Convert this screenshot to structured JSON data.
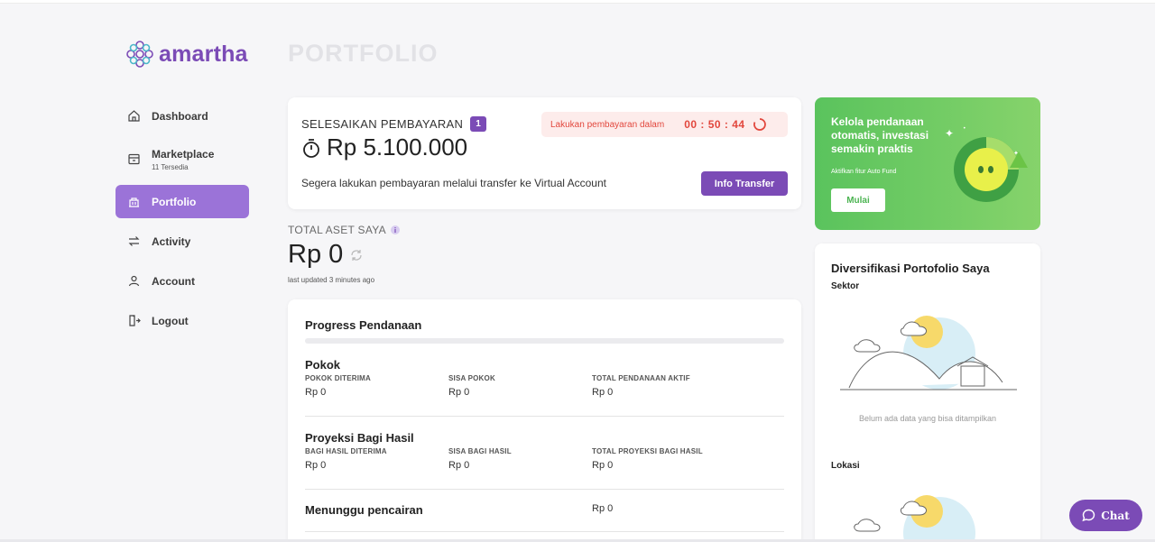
{
  "brand": {
    "name": "amartha"
  },
  "page": {
    "title": "PORTFOLIO"
  },
  "sidebar": {
    "items": [
      {
        "label": "Dashboard",
        "icon": "home-icon",
        "active": false
      },
      {
        "label": "Marketplace",
        "sub": "11 Tersedia",
        "icon": "store-icon",
        "active": false
      },
      {
        "label": "Portfolio",
        "icon": "portfolio-icon",
        "active": true
      },
      {
        "label": "Activity",
        "icon": "swap-icon",
        "active": false
      },
      {
        "label": "Account",
        "icon": "user-icon",
        "active": false
      },
      {
        "label": "Logout",
        "icon": "logout-icon",
        "active": false
      }
    ]
  },
  "payment": {
    "title": "SELESAIKAN PEMBAYARAN",
    "badge": "1",
    "amount": "Rp 5.100.000",
    "timer_label": "Lakukan pembayaran dalam",
    "timer_value": "00 : 50 : 44",
    "note": "Segera lakukan pembayaran melalui transfer ke Virtual Account",
    "button": "Info Transfer"
  },
  "assets": {
    "label": "TOTAL ASET SAYA",
    "value": "Rp 0",
    "updated": "last updated 3 minutes ago"
  },
  "progress": {
    "title": "Progress Pendanaan",
    "fill_fraction": 0,
    "sections": [
      {
        "title": "Pokok",
        "cols": [
          {
            "key": "POKOK DITERIMA",
            "value": "Rp 0"
          },
          {
            "key": "SISA POKOK",
            "value": "Rp 0"
          },
          {
            "key": "TOTAL PENDANAAN AKTIF",
            "value": "Rp 0"
          }
        ]
      },
      {
        "title": "Proyeksi Bagi Hasil",
        "cols": [
          {
            "key": "BAGI HASIL DITERIMA",
            "value": "Rp 0"
          },
          {
            "key": "SISA BAGI HASIL",
            "value": "Rp 0"
          },
          {
            "key": "TOTAL PROYEKSI BAGI HASIL",
            "value": "Rp 0"
          }
        ]
      }
    ],
    "waiting": {
      "label": "Menunggu pencairan",
      "value": "Rp 0"
    }
  },
  "promo": {
    "text": "Kelola pendanaan otomatis, investasi semakin praktis",
    "sub": "Aktifkan fitur Auto Fund",
    "button": "Mulai"
  },
  "diversification": {
    "title": "Diversifikasi Portofolio Saya",
    "sector_label": "Sektor",
    "empty_text": "Belum ada data yang bisa ditampilkan",
    "location_label": "Lokasi"
  },
  "chat": {
    "label": "Chat"
  },
  "colors": {
    "brand": "#7b4bb6",
    "accent_active": "#9b73d8",
    "promo_green": "#5ac35d",
    "timer_red": "#e2473d"
  }
}
